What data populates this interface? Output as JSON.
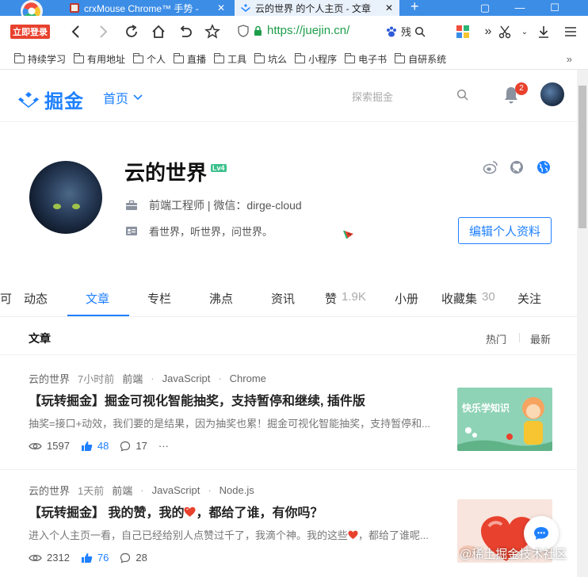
{
  "browser": {
    "login_badge": "立即登录",
    "tabs": [
      {
        "title": "crxMouse Chrome™ 手势 -",
        "active": false
      },
      {
        "title": "云的世界 的个人主页 - 文章",
        "active": true
      }
    ],
    "new_tab": "+",
    "url": {
      "scheme": "https://",
      "host": "juejin.cn/"
    },
    "search_engine_label": "残",
    "bookmarks": [
      "持续学习",
      "有用地址",
      "个人",
      "直播",
      "工具",
      "坑么",
      "小程序",
      "电子书",
      "自研系统"
    ],
    "bookmarks_more": "»"
  },
  "site": {
    "logo_text": "掘金",
    "home_nav": "首页",
    "search_placeholder": "探索掘金",
    "notification_count": "2"
  },
  "profile": {
    "name": "云的世界",
    "level": "Lv4",
    "job": "前端工程师 | 微信：dirge-cloud",
    "bio": "看世界，听世界，问世界。",
    "edit_button": "编辑个人资料"
  },
  "tabs": {
    "cut_label": "可",
    "items": [
      {
        "label": "动态",
        "count": ""
      },
      {
        "label": "文章",
        "count": ""
      },
      {
        "label": "专栏",
        "count": ""
      },
      {
        "label": "沸点",
        "count": ""
      },
      {
        "label": "资讯",
        "count": ""
      },
      {
        "label": "赞",
        "count": "1.9K"
      },
      {
        "label": "小册",
        "count": ""
      },
      {
        "label": "收藏集",
        "count": "30"
      },
      {
        "label": "关注",
        "count": ""
      }
    ]
  },
  "section": {
    "title": "文章",
    "sort_hot": "热门",
    "sort_new": "最新"
  },
  "articles": [
    {
      "author": "云的世界",
      "time": "7小时前",
      "tags": [
        "前端",
        "JavaScript",
        "Chrome"
      ],
      "title": "【玩转掘金】掘金可视化智能抽奖，支持暂停和继续, 插件版",
      "desc": "抽奖=接口+动效，我们要的是结果，因为抽奖也累！掘金可视化智能抽奖，支持暂停和...",
      "views": "1597",
      "likes": "48",
      "comments": "17",
      "more": "···",
      "thumb_text": "快乐学知识"
    },
    {
      "author": "云的世界",
      "time": "1天前",
      "tags": [
        "前端",
        "JavaScript",
        "Node.js"
      ],
      "title_a": "【玩转掘金】 我的赞，我的",
      "title_b": "，都给了谁，有你吗？",
      "desc_a": "进入个人主页一看，自己已经给别人点赞过千了，我滴个神。我的这些",
      "desc_b": "，都给了谁呢...",
      "views": "2312",
      "likes": "76",
      "comments": "28",
      "more": "···"
    }
  ],
  "watermark": "@稀土掘金技术社区",
  "colors": {
    "brand": "#1e80ff",
    "badge": "#e8412d",
    "level": "#3ac08c"
  }
}
